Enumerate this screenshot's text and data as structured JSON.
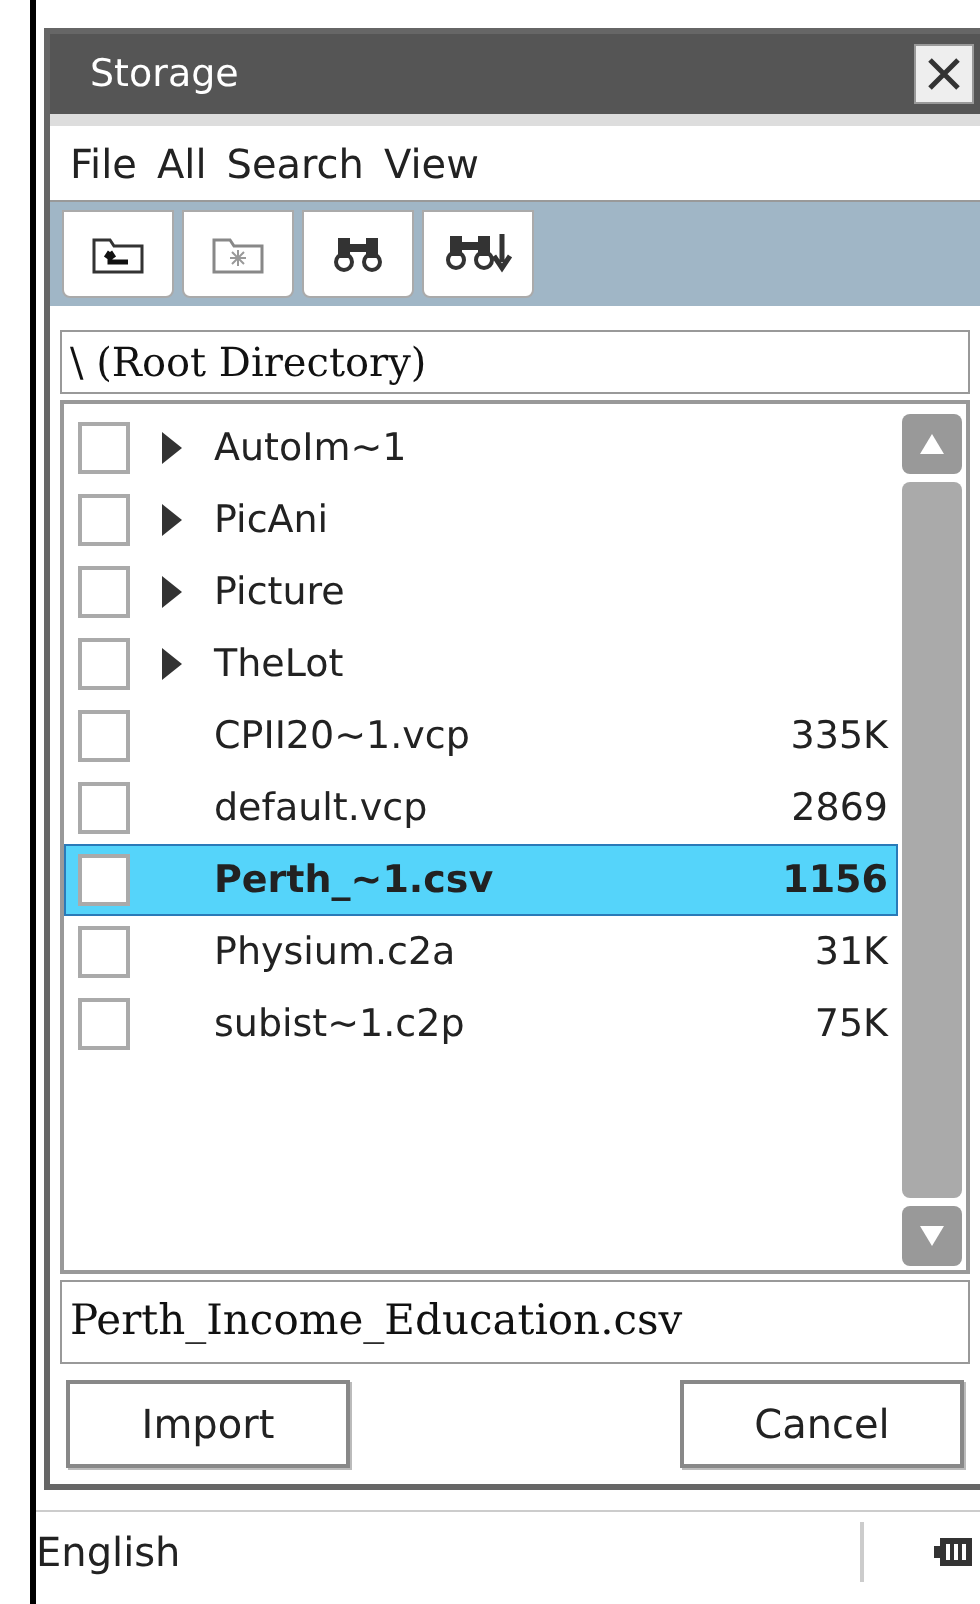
{
  "window": {
    "title": "Storage"
  },
  "menu": [
    "File",
    "All",
    "Search",
    "View"
  ],
  "path": "\\ (Root Directory)",
  "items": [
    {
      "kind": "folder",
      "name": "AutoIm~1",
      "checked": false,
      "selected": false
    },
    {
      "kind": "folder",
      "name": "PicAni",
      "checked": false,
      "selected": false
    },
    {
      "kind": "folder",
      "name": "Picture",
      "checked": false,
      "selected": false
    },
    {
      "kind": "folder",
      "name": "TheLot",
      "checked": false,
      "selected": false
    },
    {
      "kind": "file",
      "name": "CPII20~1.vcp",
      "size": "335K",
      "checked": false,
      "selected": false
    },
    {
      "kind": "file",
      "name": "default.vcp",
      "size": "2869",
      "checked": false,
      "selected": false
    },
    {
      "kind": "file",
      "name": "Perth_~1.csv",
      "size": "1156",
      "checked": false,
      "selected": true
    },
    {
      "kind": "file",
      "name": "Physium.c2a",
      "size": "31K",
      "checked": false,
      "selected": false
    },
    {
      "kind": "file",
      "name": "subist~1.c2p",
      "size": "75K",
      "checked": false,
      "selected": false
    }
  ],
  "filename": "Perth_Income_Education.csv",
  "buttons": [
    "Import",
    "Cancel"
  ],
  "status_bar": {
    "input_mode": "English"
  }
}
